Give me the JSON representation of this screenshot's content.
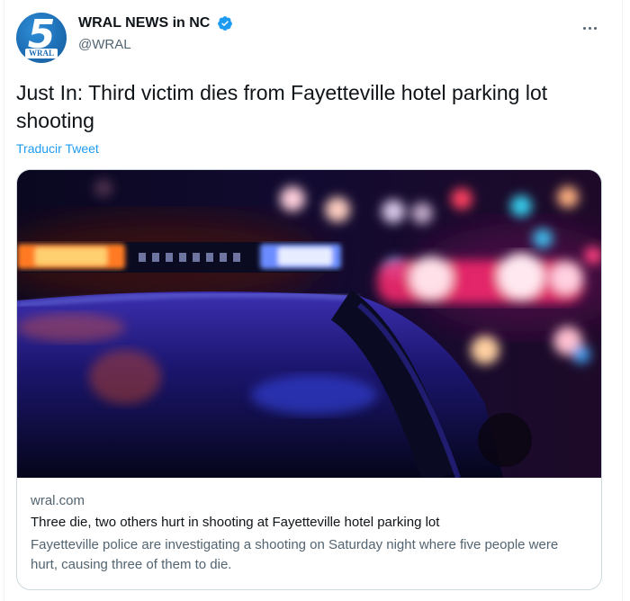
{
  "account": {
    "display_name": "WRAL NEWS in NC",
    "handle": "@WRAL",
    "avatar_number": "5",
    "avatar_text": "WRAL",
    "verified": true,
    "avatar_color": "#1e6fb5"
  },
  "tweet": {
    "text": "Just In: Third victim dies from Fayetteville hotel parking lot shooting",
    "translate_label": "Traducir Tweet"
  },
  "card": {
    "domain": "wral.com",
    "title": "Three die, two others hurt in shooting at Fayetteville hotel parking lot",
    "description": "Fayetteville police are investigating a shooting on Saturday night where five people were hurt, causing three of them to die."
  },
  "icons": {
    "more": "more-options-icon",
    "verified": "verified-badge-icon"
  },
  "colors": {
    "link": "#1d9bf0",
    "secondary_text": "#536471",
    "primary_text": "#0f1419",
    "verified": "#1d9bf0"
  }
}
